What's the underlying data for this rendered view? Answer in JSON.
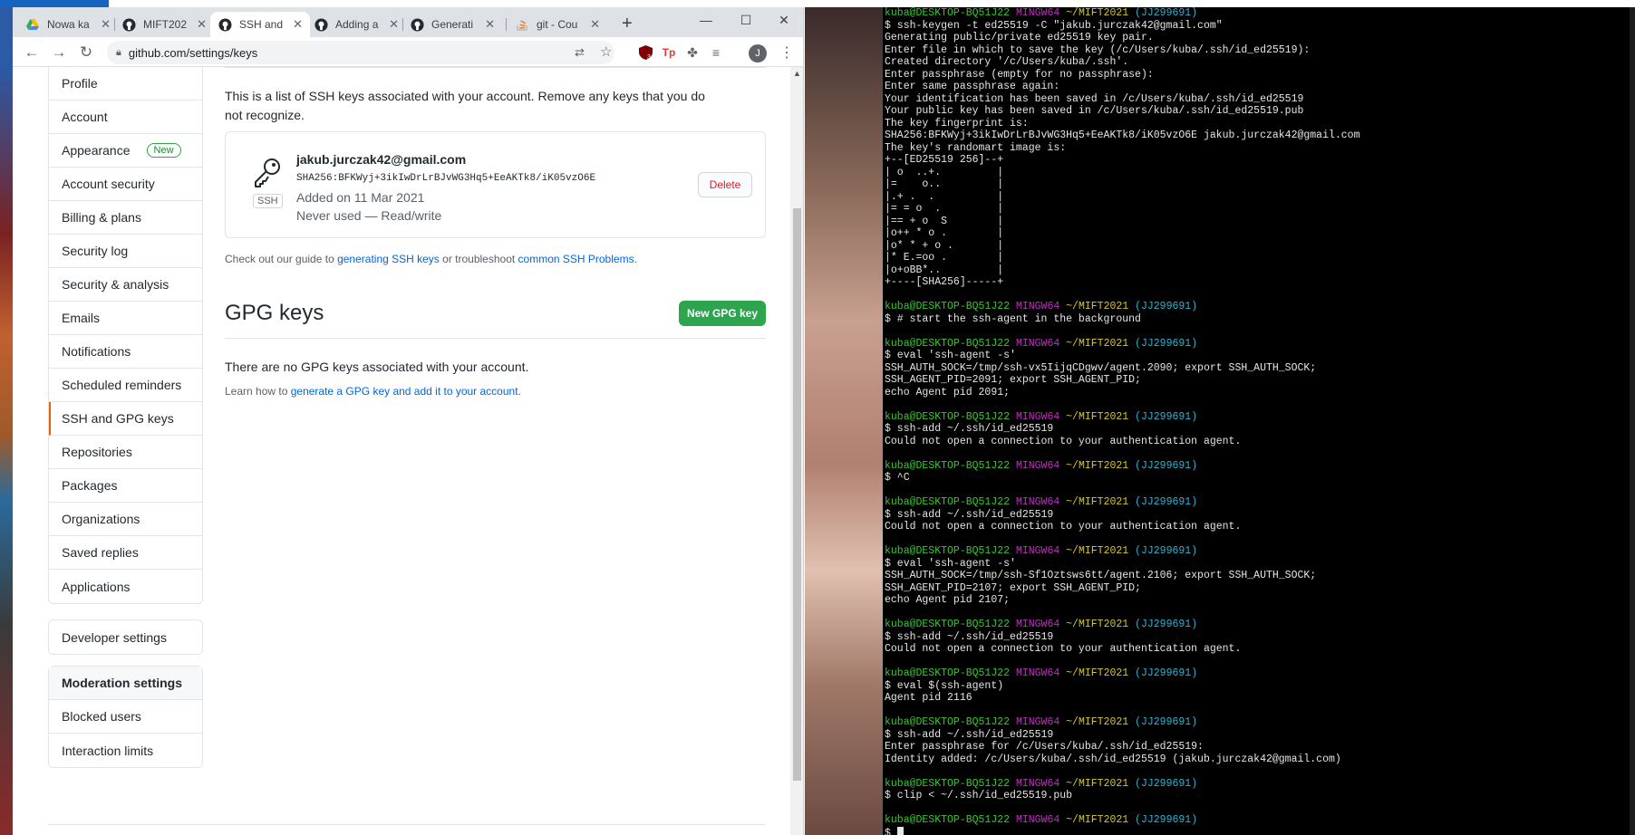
{
  "browser": {
    "tabs": [
      {
        "title": "Nowa ka",
        "icon": "google-drive-icon"
      },
      {
        "title": "MIFT202",
        "icon": "github-icon"
      },
      {
        "title": "SSH and",
        "icon": "github-icon"
      },
      {
        "title": "Adding a",
        "icon": "github-icon"
      },
      {
        "title": "Generati",
        "icon": "github-icon"
      },
      {
        "title": "git - Cou",
        "icon": "stackoverflow-icon"
      }
    ],
    "url": "github.com/settings/keys",
    "avatar_initial": "J",
    "ext_badge": "3"
  },
  "settings_nav": {
    "items": [
      {
        "label": "Profile"
      },
      {
        "label": "Account"
      },
      {
        "label": "Appearance",
        "badge": "New"
      },
      {
        "label": "Account security"
      },
      {
        "label": "Billing & plans"
      },
      {
        "label": "Security log"
      },
      {
        "label": "Security & analysis"
      },
      {
        "label": "Emails"
      },
      {
        "label": "Notifications"
      },
      {
        "label": "Scheduled reminders"
      },
      {
        "label": "SSH and GPG keys",
        "selected": true
      },
      {
        "label": "Repositories"
      },
      {
        "label": "Packages"
      },
      {
        "label": "Organizations"
      },
      {
        "label": "Saved replies"
      },
      {
        "label": "Applications"
      }
    ],
    "developer": "Developer settings",
    "moderation": {
      "heading": "Moderation settings",
      "items": [
        "Blocked users",
        "Interaction limits"
      ]
    }
  },
  "ssh": {
    "description": "This is a list of SSH keys associated with your account. Remove any keys that you do not recognize.",
    "key": {
      "type_label": "SSH",
      "title": "jakub.jurczak42@gmail.com",
      "fingerprint": "SHA256:BFKWyj+3ikIwDrLrBJvWG3Hq5+EeAKTk8/iK05vzO6E",
      "added": "Added on 11 Mar 2021",
      "usage": "Never used — Read/write",
      "delete_label": "Delete"
    },
    "guide": {
      "prefix": "Check out our guide to ",
      "link1": "generating SSH keys",
      "middle": " or troubleshoot ",
      "link2": "common SSH Problems",
      "suffix": "."
    }
  },
  "gpg": {
    "title": "GPG keys",
    "new_button": "New GPG key",
    "empty": "There are no GPG keys associated with your account.",
    "learn_prefix": "Learn how to ",
    "learn_link": "generate a GPG key and add it to your account",
    "learn_suffix": "."
  },
  "terminal": {
    "prompt": {
      "user": "kuba@DESKTOP-BQ51J22",
      "host": "MINGW64",
      "path": "~/MIFT2021",
      "branch": "(JJ299691)"
    },
    "lines": [
      {
        "kind": "prompt"
      },
      {
        "kind": "text",
        "text": "$ ssh-keygen -t ed25519 -C \"jakub.jurczak42@gmail.com\""
      },
      {
        "kind": "text",
        "text": "Generating public/private ed25519 key pair."
      },
      {
        "kind": "text",
        "text": "Enter file in which to save the key (/c/Users/kuba/.ssh/id_ed25519):"
      },
      {
        "kind": "text",
        "text": "Created directory '/c/Users/kuba/.ssh'."
      },
      {
        "kind": "text",
        "text": "Enter passphrase (empty for no passphrase):"
      },
      {
        "kind": "text",
        "text": "Enter same passphrase again:"
      },
      {
        "kind": "text",
        "text": "Your identification has been saved in /c/Users/kuba/.ssh/id_ed25519"
      },
      {
        "kind": "text",
        "text": "Your public key has been saved in /c/Users/kuba/.ssh/id_ed25519.pub"
      },
      {
        "kind": "text",
        "text": "The key fingerprint is:"
      },
      {
        "kind": "text",
        "text": "SHA256:BFKWyj+3ikIwDrLrBJvWG3Hq5+EeAKTk8/iK05vzO6E jakub.jurczak42@gmail.com"
      },
      {
        "kind": "text",
        "text": "The key's randomart image is:"
      },
      {
        "kind": "text",
        "text": "+--[ED25519 256]--+"
      },
      {
        "kind": "text",
        "text": "| o  ..+.         |"
      },
      {
        "kind": "text",
        "text": "|=    o..         |"
      },
      {
        "kind": "text",
        "text": "|.+ .  .          |"
      },
      {
        "kind": "text",
        "text": "|= = o  .         |"
      },
      {
        "kind": "text",
        "text": "|== + o  S        |"
      },
      {
        "kind": "text",
        "text": "|o++ * o .        |"
      },
      {
        "kind": "text",
        "text": "|o* * + o .       |"
      },
      {
        "kind": "text",
        "text": "|* E.=oo .        |"
      },
      {
        "kind": "text",
        "text": "|o+oBB*..         |"
      },
      {
        "kind": "text",
        "text": "+----[SHA256]-----+"
      },
      {
        "kind": "blank"
      },
      {
        "kind": "prompt"
      },
      {
        "kind": "text",
        "text": "$ # start the ssh-agent in the background"
      },
      {
        "kind": "blank"
      },
      {
        "kind": "prompt"
      },
      {
        "kind": "text",
        "text": "$ eval 'ssh-agent -s'"
      },
      {
        "kind": "text",
        "text": "SSH_AUTH_SOCK=/tmp/ssh-vx5IijqCDgwv/agent.2090; export SSH_AUTH_SOCK;"
      },
      {
        "kind": "text",
        "text": "SSH_AGENT_PID=2091; export SSH_AGENT_PID;"
      },
      {
        "kind": "text",
        "text": "echo Agent pid 2091;"
      },
      {
        "kind": "blank"
      },
      {
        "kind": "prompt"
      },
      {
        "kind": "text",
        "text": "$ ssh-add ~/.ssh/id_ed25519"
      },
      {
        "kind": "text",
        "text": "Could not open a connection to your authentication agent."
      },
      {
        "kind": "blank"
      },
      {
        "kind": "prompt"
      },
      {
        "kind": "text",
        "text": "$ ^C"
      },
      {
        "kind": "blank"
      },
      {
        "kind": "prompt"
      },
      {
        "kind": "text",
        "text": "$ ssh-add ~/.ssh/id_ed25519"
      },
      {
        "kind": "text",
        "text": "Could not open a connection to your authentication agent."
      },
      {
        "kind": "blank"
      },
      {
        "kind": "prompt"
      },
      {
        "kind": "text",
        "text": "$ eval 'ssh-agent -s'"
      },
      {
        "kind": "text",
        "text": "SSH_AUTH_SOCK=/tmp/ssh-Sf1Oztsws6tt/agent.2106; export SSH_AUTH_SOCK;"
      },
      {
        "kind": "text",
        "text": "SSH_AGENT_PID=2107; export SSH_AGENT_PID;"
      },
      {
        "kind": "text",
        "text": "echo Agent pid 2107;"
      },
      {
        "kind": "blank"
      },
      {
        "kind": "prompt"
      },
      {
        "kind": "text",
        "text": "$ ssh-add ~/.ssh/id_ed25519"
      },
      {
        "kind": "text",
        "text": "Could not open a connection to your authentication agent."
      },
      {
        "kind": "blank"
      },
      {
        "kind": "prompt"
      },
      {
        "kind": "text",
        "text": "$ eval $(ssh-agent)"
      },
      {
        "kind": "text",
        "text": "Agent pid 2116"
      },
      {
        "kind": "blank"
      },
      {
        "kind": "prompt"
      },
      {
        "kind": "text",
        "text": "$ ssh-add ~/.ssh/id_ed25519"
      },
      {
        "kind": "text",
        "text": "Enter passphrase for /c/Users/kuba/.ssh/id_ed25519:"
      },
      {
        "kind": "text",
        "text": "Identity added: /c/Users/kuba/.ssh/id_ed25519 (jakub.jurczak42@gmail.com)"
      },
      {
        "kind": "blank"
      },
      {
        "kind": "prompt"
      },
      {
        "kind": "text",
        "text": "$ clip < ~/.ssh/id_ed25519.pub"
      },
      {
        "kind": "blank"
      },
      {
        "kind": "prompt"
      },
      {
        "kind": "cursor",
        "text": "$ "
      }
    ]
  }
}
